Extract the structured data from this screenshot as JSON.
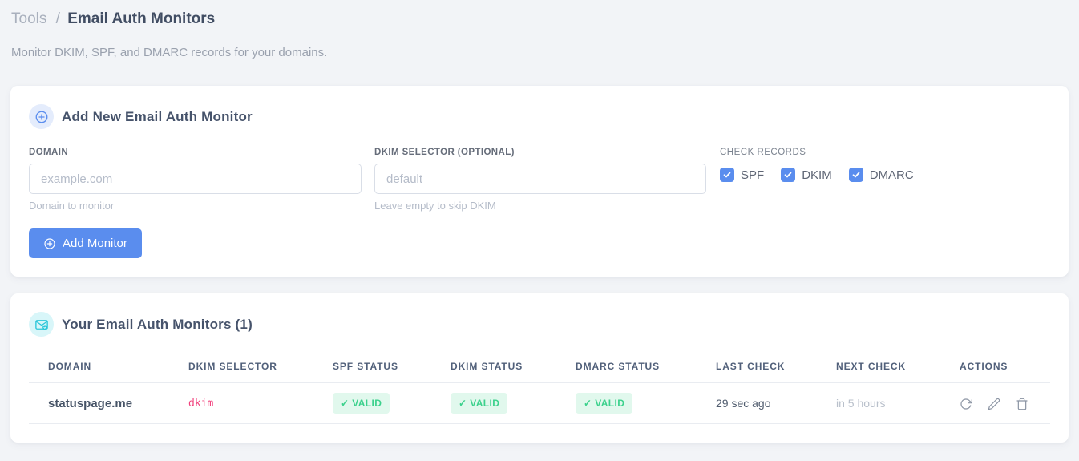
{
  "page": {
    "breadcrumb": {
      "parent": "Tools",
      "separator": "/",
      "current": "Email Auth Monitors"
    },
    "subtitle": "Monitor DKIM, SPF, and DMARC records for your domains."
  },
  "add_card": {
    "icon": "plus-circle-icon",
    "title": "Add New Email Auth Monitor",
    "domain_field": {
      "label": "DOMAIN",
      "placeholder": "example.com",
      "value": "",
      "helper": "Domain to monitor"
    },
    "dkim_field": {
      "label": "DKIM SELECTOR (OPTIONAL)",
      "placeholder": "default",
      "value": "",
      "helper": "Leave empty to skip DKIM"
    },
    "check_records": {
      "label": "CHECK RECORDS",
      "options": [
        {
          "label": "SPF",
          "checked": true
        },
        {
          "label": "DKIM",
          "checked": true
        },
        {
          "label": "DMARC",
          "checked": true
        }
      ]
    },
    "add_button_label": "Add Monitor"
  },
  "monitors_card": {
    "icon": "mail-check-icon",
    "title": "Your Email Auth Monitors (1)",
    "columns": [
      "DOMAIN",
      "DKIM SELECTOR",
      "SPF STATUS",
      "DKIM STATUS",
      "DMARC STATUS",
      "LAST CHECK",
      "NEXT CHECK",
      "ACTIONS"
    ],
    "rows": [
      {
        "domain": "statuspage.me",
        "dkim_selector": "dkim",
        "spf_status": "✓ VALID",
        "dkim_status": "✓ VALID",
        "dmarc_status": "✓ VALID",
        "last_check": "29 sec ago",
        "next_check": "in 5 hours",
        "actions": [
          "refresh-icon",
          "edit-pencil-icon",
          "trash-icon"
        ]
      }
    ]
  },
  "colors": {
    "accent_blue": "#5a8dee",
    "accent_teal": "#2cc7d9",
    "valid_green": "#3bd18c",
    "valid_bg": "#e1f8ed",
    "code_pink": "#f1437e",
    "page_bg": "#f2f4f7"
  }
}
